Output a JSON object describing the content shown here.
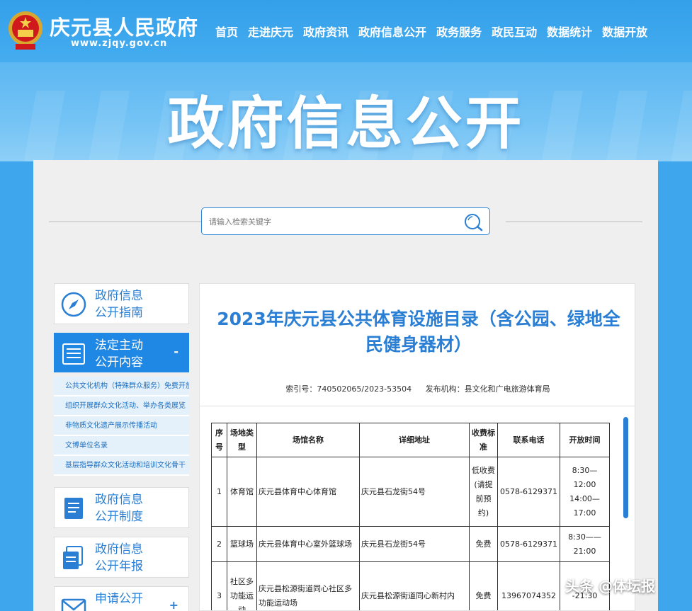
{
  "header": {
    "site_title": "庆元县人民政府",
    "site_url": "www.zjqy.gov.cn",
    "nav": [
      "首页",
      "走进庆元",
      "政府资讯",
      "政府信息公开",
      "政务服务",
      "政民互动",
      "数据统计",
      "数据开放"
    ]
  },
  "banner": {
    "title": "政府信息公开"
  },
  "search": {
    "placeholder": "请输入检索关键字"
  },
  "sidebar": {
    "cards": [
      {
        "label_line1": "政府信息",
        "label_line2": "公开指南",
        "icon": "compass-icon"
      },
      {
        "label_line1": "法定主动",
        "label_line2": "公开内容",
        "icon": "list-doc-icon",
        "toggle": "-"
      },
      {
        "label_line1": "政府信息",
        "label_line2": "公开制度",
        "icon": "document-icon"
      },
      {
        "label_line1": "政府信息",
        "label_line2": "公开年报",
        "icon": "report-icon"
      },
      {
        "label_line1": "申请公开",
        "label_line2": "",
        "icon": "mail-icon",
        "toggle": "+"
      }
    ],
    "sub_items": [
      "公共文化机构（特殊群众服务）免费开放",
      "组织开展群众文化活动、举办各类展览",
      "非物质文化遗产展示传播活动",
      "文博单位名录",
      "基层指导群众文化活动和培训文化骨干"
    ]
  },
  "document": {
    "title": "2023年庆元县公共体育设施目录（含公园、绿地全民健身器材）",
    "index_no": "索引号：740502065/2023-53504",
    "publisher": "发布机构：县文化和广电旅游体育局"
  },
  "table": {
    "headers": [
      "序号",
      "场地类型",
      "场馆名称",
      "详细地址",
      "收费标准",
      "联系电话",
      "开放时间"
    ],
    "rows": [
      [
        "1",
        "体育馆",
        "庆元县体育中心体育馆",
        "庆元县石龙街54号",
        "低收费(请提前预约)",
        "0578-6129371",
        "8:30—12:00 14:00—17:00"
      ],
      [
        "2",
        "篮球场",
        "庆元县体育中心室外篮球场",
        "庆元县石龙街54号",
        "免费",
        "0578-6129371",
        "8:30——21:00"
      ],
      [
        "3",
        "社区多功能运动",
        "庆元县松源街道同心社区多功能运动场",
        "庆元县松源街道同心新村内",
        "免费",
        "13967074352",
        "-21:30"
      ]
    ]
  },
  "watermark": "头条 @体坛报"
}
